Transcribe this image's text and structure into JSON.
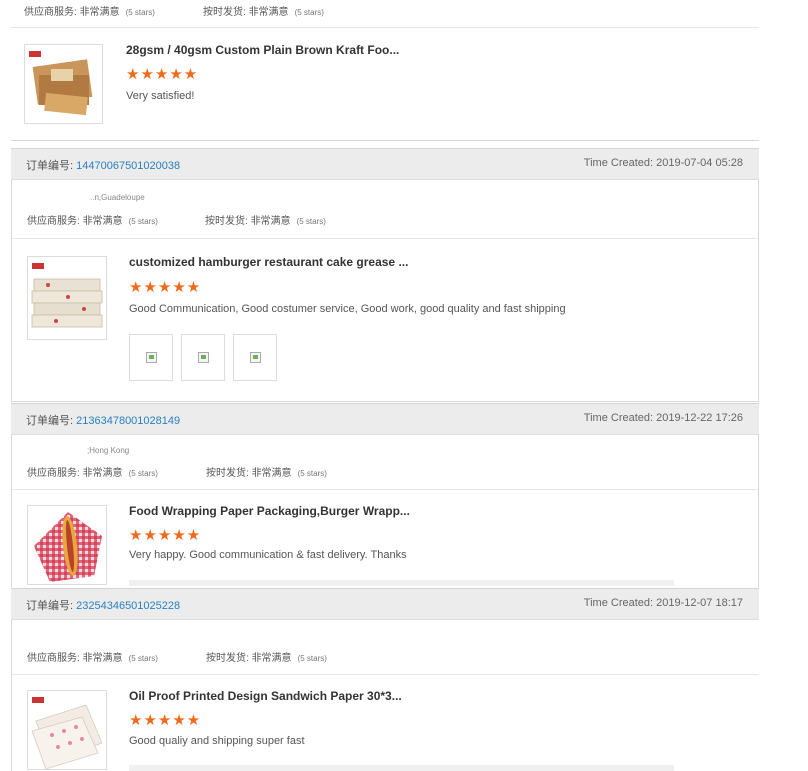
{
  "labels": {
    "order_number": "订单编号:",
    "time_created": "Time Created:",
    "supplier_service": "供应商服务:",
    "on_time_delivery": "按时发货:",
    "very_satisfied": "非常满意",
    "five_stars": "(5 stars)",
    "stars_glyphs": "★★★★★"
  },
  "top_fragment": {
    "product_name": "28gsm / 40gsm Custom Plain Brown Kraft Foo...",
    "rating": 5,
    "review": "Very satisfied!"
  },
  "orders": [
    {
      "order_number": "14470067501020038",
      "time_created": "2019-07-04 05:28",
      "location": "..n,Guadeloupe",
      "product_name": "customized hamburger restaurant cake grease ...",
      "rating": 5,
      "review": "Good Communication, Good costumer service, Good work, good quality and fast shipping",
      "photos": 3
    },
    {
      "order_number": "21363478001028149",
      "time_created": "2019-12-22 17:26",
      "location": ";Hong Kong",
      "product_name": "Food Wrapping Paper Packaging,Burger Wrapp...",
      "rating": 5,
      "review": "Very happy. Good communication & fast delivery. Thanks"
    },
    {
      "order_number": "23254346501025228",
      "time_created": "2019-12-07 18:17",
      "location": "",
      "product_name": "Oil Proof Printed Design Sandwich Paper 30*3...",
      "rating": 5,
      "review": "Good qualiy and shipping super fast"
    }
  ],
  "colors": {
    "star": "#f06a1c",
    "order_link": "#2a7fc0",
    "header_bg": "#ececec"
  }
}
